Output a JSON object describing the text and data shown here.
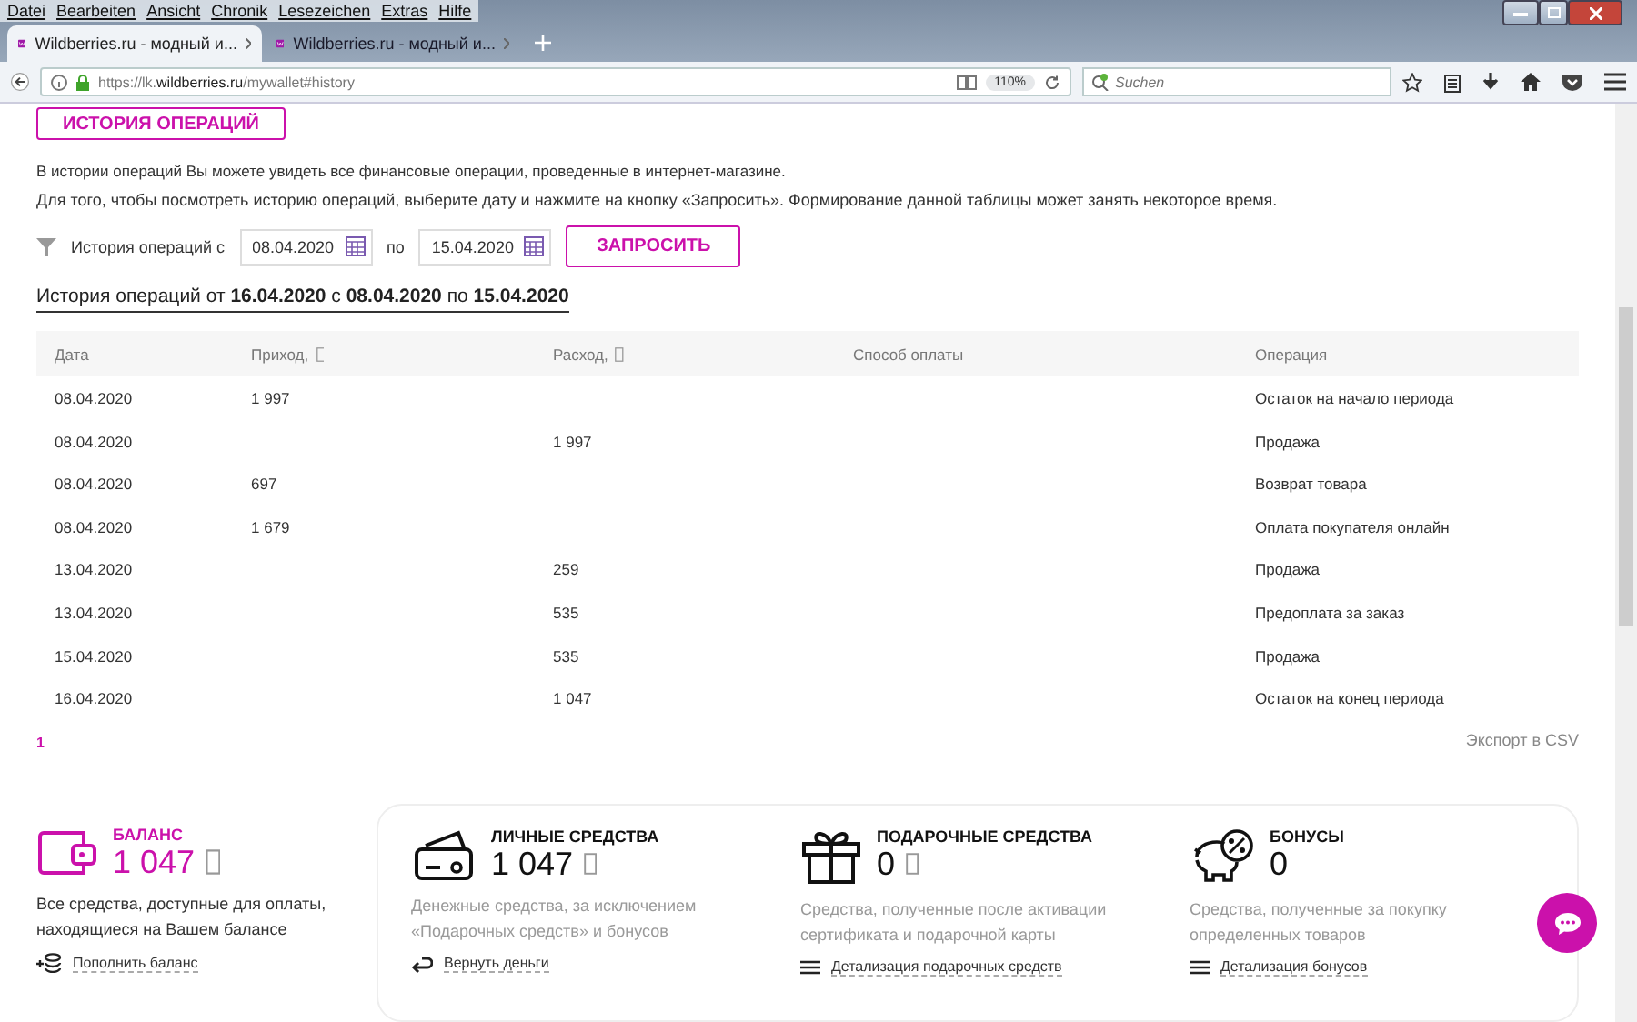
{
  "browser": {
    "menu": [
      "Datei",
      "Bearbeiten",
      "Ansicht",
      "Chronik",
      "Lesezeichen",
      "Extras",
      "Hilfe"
    ],
    "tabs": [
      {
        "title": "Wildberries.ru - модный и...",
        "selected": true
      },
      {
        "title": "Wildberries.ru - модный и...",
        "selected": false
      }
    ],
    "url_prefix": "https://lk.",
    "url_domain": "wildberries.ru",
    "url_path": "/mywallet#history",
    "zoom": "110%",
    "search": {
      "placeholder": "Suchen"
    }
  },
  "page": {
    "section_button": "ИСТОРИЯ ОПЕРАЦИЙ",
    "intro": [
      "В истории операций Вы можете увидеть все финансовые операции, проведенные в интернет-магазине.",
      "Для того, чтобы посмотреть историю операций, выберите дату и нажмите на кнопку «Запросить». Формирование данной таблицы может занять некоторое время."
    ],
    "filter": {
      "label": "История операций с",
      "from": "08.04.2020",
      "to_label": "по",
      "to": "15.04.2020",
      "button": "ЗАПРОСИТЬ"
    },
    "report_title": "История операций от **16.04.2020** с **08.04.2020** по **15.04.2020**",
    "table": {
      "columns": [
        {
          "label": "Дата",
          "currency": false
        },
        {
          "label": "Приход,",
          "currency": true
        },
        {
          "label": "Расход,",
          "currency": true
        },
        {
          "label": "Способ оплаты",
          "currency": false
        },
        {
          "label": "Операция",
          "currency": false
        }
      ],
      "rows": [
        [
          "08.04.2020",
          "1 997",
          "",
          "",
          "Остаток на начало периода"
        ],
        [
          "08.04.2020",
          "",
          "1 997",
          "",
          "Продажа"
        ],
        [
          "08.04.2020",
          "697",
          "",
          "",
          "Возврат товара"
        ],
        [
          "08.04.2020",
          "1 679",
          "",
          "",
          "Оплата покупателя онлайн"
        ],
        [
          "13.04.2020",
          "",
          "259",
          "",
          "Продажа"
        ],
        [
          "13.04.2020",
          "",
          "535",
          "",
          "Предоплата за заказ"
        ],
        [
          "15.04.2020",
          "",
          "535",
          "",
          "Продажа"
        ],
        [
          "16.04.2020",
          "",
          "1 047",
          "",
          "Остаток на конец периода"
        ]
      ]
    },
    "pagination": [
      "1"
    ],
    "export": "Экспорт в CSV",
    "balance": {
      "kind": "wallet",
      "title": "БАЛАНС",
      "amount": "1 047",
      "currency": true,
      "description": "Все средства, доступные для оплаты, находящиеся на Вашем балансе",
      "action": {
        "kind": "topup",
        "label": "Пополнить баланс"
      }
    },
    "funds": [
      {
        "kind": "card",
        "title": "ЛИЧНЫЕ СРЕДСТВА",
        "amount": "1 047",
        "currency": true,
        "description": "Денежные средства, за исключением «Подарочных средств» и бонусов",
        "action": {
          "kind": "return",
          "label": "Вернуть деньги"
        }
      },
      {
        "kind": "gift",
        "title": "ПОДАРОЧНЫЕ СРЕДСТВА",
        "amount": "0",
        "currency": true,
        "description": "Средства, полученные после активации сертификата и подарочной карты",
        "action": {
          "kind": "list",
          "label": "Детализация подарочных средств"
        }
      },
      {
        "kind": "piggy",
        "title": "БОНУСЫ",
        "amount": "0",
        "currency": false,
        "description": "Средства, полученные за покупку определенных товаров",
        "action": {
          "kind": "list",
          "label": "Детализация бонусов"
        }
      }
    ]
  }
}
